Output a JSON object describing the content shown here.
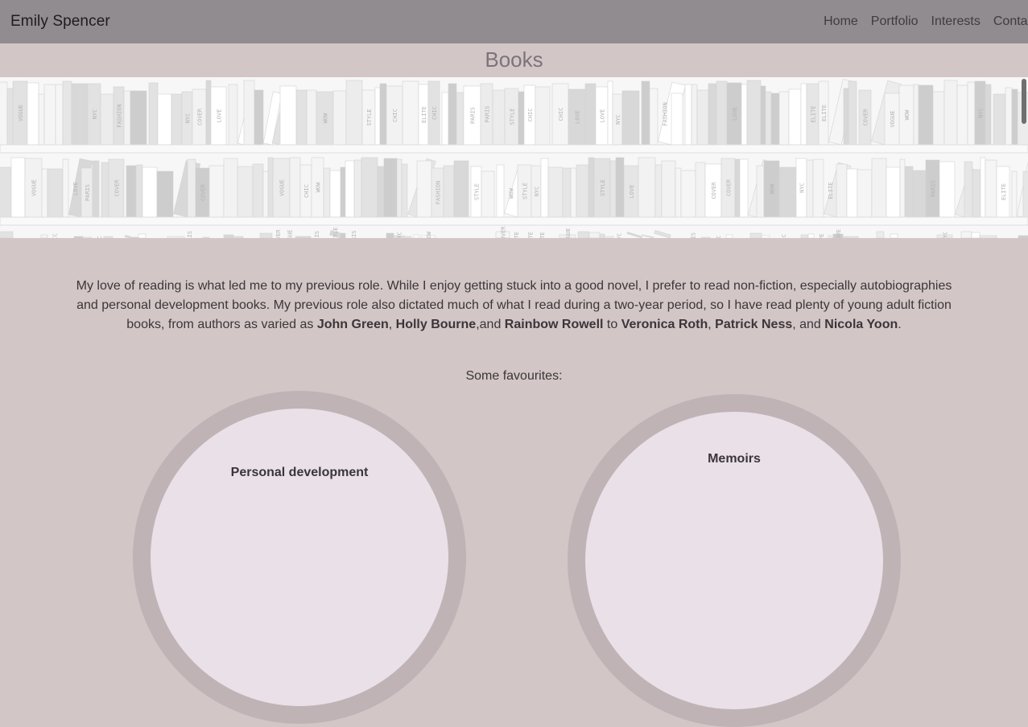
{
  "navbar": {
    "brand": "Emily Spencer",
    "links": [
      "Home",
      "Portfolio",
      "Interests",
      "Contact"
    ]
  },
  "section": {
    "title": "Books"
  },
  "banner": {
    "description_icon": "bookshelf-image",
    "spine_labels": [
      "NYC",
      "PARIS",
      "FASHION",
      "CHIC",
      "LOVE",
      "STYLE",
      "VOGUE",
      "ELITE",
      "COVER",
      "WOW"
    ]
  },
  "intro": {
    "p1": "My love of reading is what led me to my previous role. While I enjoy getting stuck into a good novel, I prefer to read non-fiction, especially autobiographies and personal development books. My previous role also dictated much of what I read during a two-year period, so I have read plenty of young adult fiction books, from authors as varied as ",
    "authors": [
      "John Green",
      "Holly Bourne",
      "Rainbow Rowell",
      "Veronica Roth",
      "Patrick Ness",
      "Nicola Yoon"
    ],
    "sep1": ", ",
    "sep2": ",and ",
    "sep3": " to ",
    "sep4": ", ",
    "sep5": ", and ",
    "end": "."
  },
  "favourites": {
    "label": "Some favourites:",
    "categories": [
      {
        "title": "Personal development"
      },
      {
        "title": "Memoirs"
      }
    ]
  },
  "colors": {
    "page_bg": "#d3c6c7",
    "navbar_bg": "#908c90",
    "circle_fill": "#e9e0e8",
    "circle_ring": "#bfb3b5"
  }
}
